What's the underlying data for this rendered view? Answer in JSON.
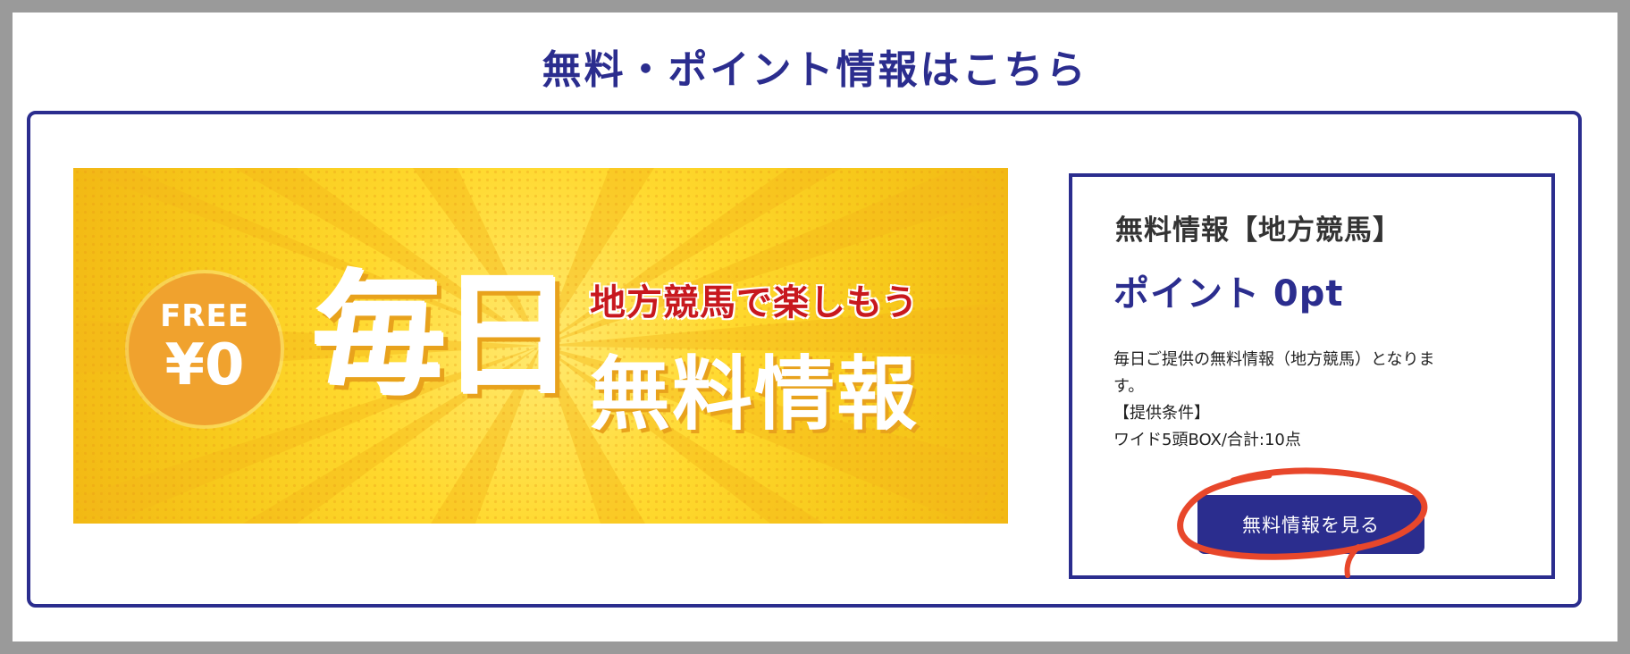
{
  "heading": "無料・ポイント情報はこちら",
  "banner": {
    "badge_top": "FREE",
    "badge_bottom": "¥0",
    "big_text": "毎日",
    "tagline": "地方競馬で楽しもう",
    "big_info": "無料情報",
    "colors": {
      "background": "#ffd92e",
      "badge": "#f0a22e",
      "tagline": "#c8181e"
    }
  },
  "info": {
    "title": "無料情報【地方競馬】",
    "points": "ポイント 0pt",
    "description_line1": "毎日ご提供の無料情報（地方競馬）となりま",
    "description_line2": "す。",
    "condition_label": "【提供条件】",
    "condition_value": "ワイド5頭BOX/合計:10点",
    "button_label": "無料情報を見る"
  },
  "colors": {
    "accent": "#2b2d8e",
    "annotation": "#e8472b"
  }
}
